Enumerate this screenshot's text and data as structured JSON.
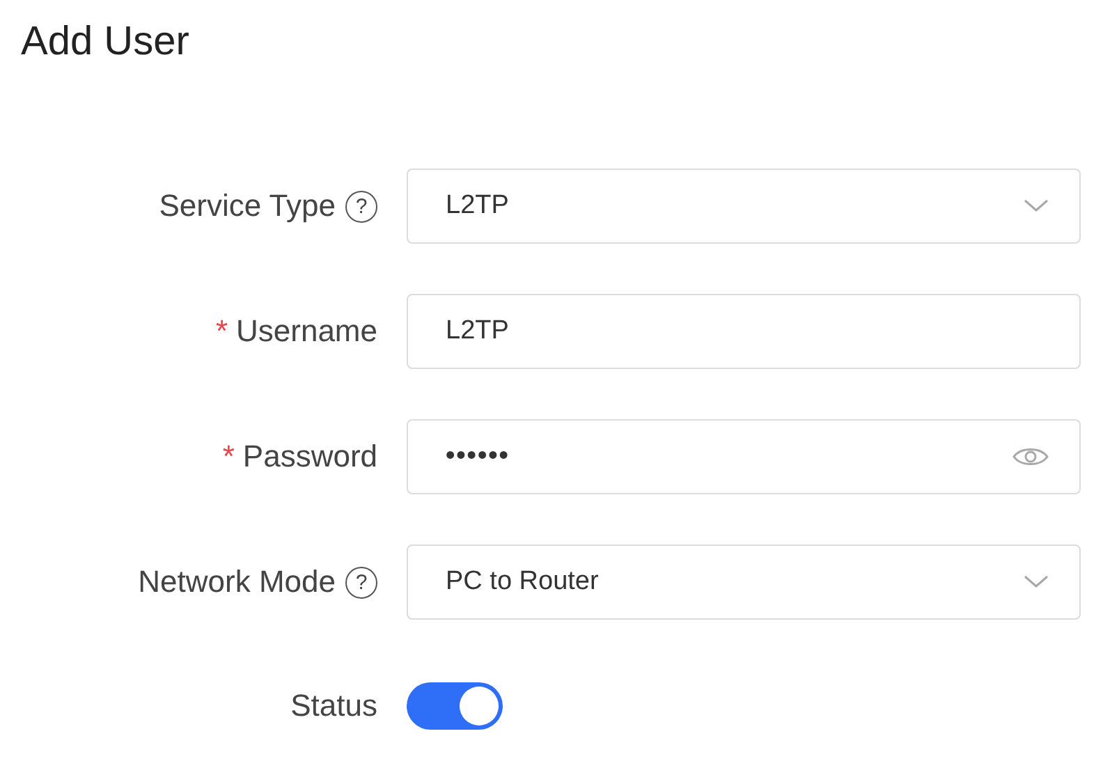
{
  "title": "Add User",
  "fields": [
    {
      "kind": "select",
      "label": "Service Type",
      "help": "?",
      "value": "L2TP"
    },
    {
      "kind": "text",
      "label": "Username",
      "required_mark": "*",
      "value": "L2TP"
    },
    {
      "kind": "password",
      "label": "Password",
      "required_mark": "*",
      "value": "••••••"
    },
    {
      "kind": "select",
      "label": "Network Mode",
      "help": "?",
      "value": "PC to Router"
    },
    {
      "kind": "toggle",
      "label": "Status",
      "on": true
    }
  ]
}
